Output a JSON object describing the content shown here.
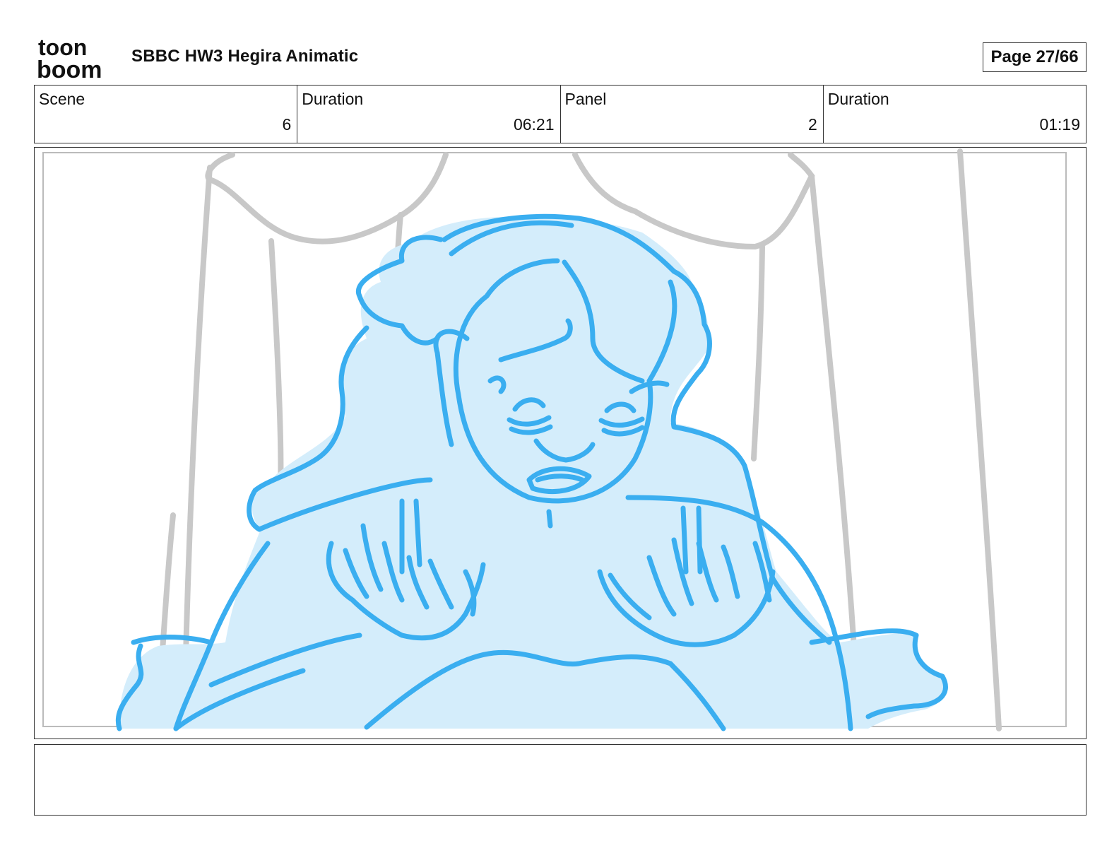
{
  "header": {
    "logo_line1": "toon",
    "logo_line2": "boom",
    "project_title": "SBBC HW3 Hegira Animatic",
    "page": "Page 27/66"
  },
  "info": {
    "scene_label": "Scene",
    "scene_value": "6",
    "scene_duration_label": "Duration",
    "scene_duration_value": "06:21",
    "panel_label": "Panel",
    "panel_value": "2",
    "panel_duration_label": "Duration",
    "panel_duration_value": "01:19"
  },
  "panel": {
    "sketch_color": "#3aaef0",
    "fill_color": "#d4edfb",
    "background_line_color": "#c8c8c8"
  },
  "caption": {
    "text": ""
  }
}
